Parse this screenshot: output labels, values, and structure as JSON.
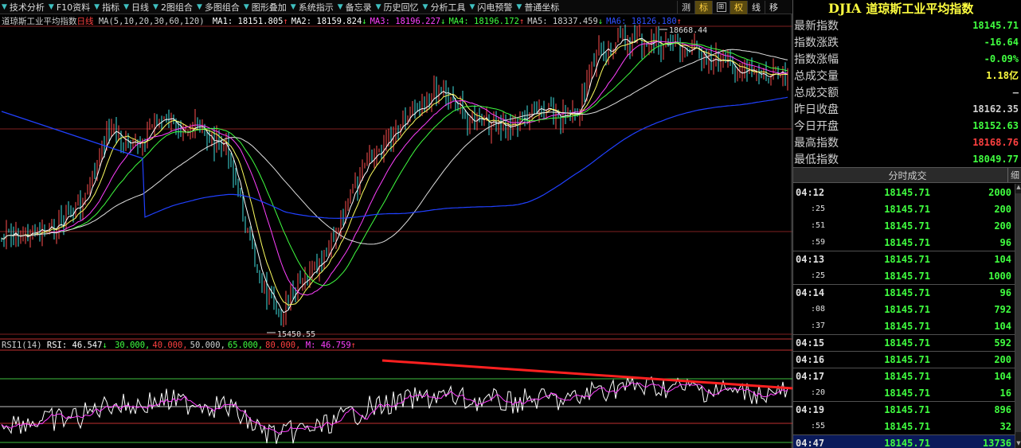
{
  "toolbar": {
    "items": [
      "技术分析",
      "F10资料",
      "指标",
      "日线",
      "2图组合",
      "多图组合",
      "图形叠加",
      "系统指示",
      "备忘录",
      "历史回忆",
      "分析工具",
      "闪电预警",
      "普通坐标"
    ],
    "mini": [
      "测",
      "标",
      "⊞",
      "权",
      "线",
      "移"
    ]
  },
  "chart": {
    "title": "道琼斯工业平均指数",
    "period": "日线",
    "ma_params": "MA(5,10,20,30,60,120)",
    "ma": [
      {
        "label": "MA1: 18151.805",
        "arrow": "↑",
        "color": "#ffffff"
      },
      {
        "label": "MA2: 18159.824",
        "arrow": "↓",
        "color": "#ffffff"
      },
      {
        "label": "MA3: 18196.227",
        "arrow": "↓",
        "color": "#ff40ff"
      },
      {
        "label": "MA4: 18196.172",
        "arrow": "↑",
        "color": "#40ff40"
      },
      {
        "label": "MA5: 18337.459",
        "arrow": "↓",
        "color": "#d0d0d0"
      },
      {
        "label": "MA6: 18126.180",
        "arrow": "↑",
        "color": "#3050ff"
      }
    ],
    "high_label": "18668.44",
    "low_label": "15450.55",
    "rsi": {
      "name": "RSI1(14)",
      "value": "RSI: 46.547",
      "value_arrow": "↓",
      "levels": [
        {
          "label": "30.000,",
          "color": "#40ff40"
        },
        {
          "label": "40.000,",
          "color": "#ff4040"
        },
        {
          "label": "50.000,",
          "color": "#d0d0d0"
        },
        {
          "label": "65.000,",
          "color": "#40ff40"
        },
        {
          "label": "80.000,",
          "color": "#ff4040"
        }
      ],
      "m": "M: 46.759",
      "m_arrow": "↑"
    }
  },
  "chart_data": {
    "type": "line",
    "title": "道琼斯工业平均指数",
    "price_range": [
      15450.55,
      18668.44
    ],
    "rsi_levels": [
      30,
      40,
      50,
      65,
      80
    ]
  },
  "panel": {
    "code": "DJIA",
    "name": "道琼斯工业平均指数",
    "stats": [
      {
        "label": "最新指数",
        "value": "18145.71",
        "color": "#40ff40"
      },
      {
        "label": "指数涨跌",
        "value": "-16.64",
        "color": "#40ff40"
      },
      {
        "label": "指数涨幅",
        "value": "-0.09%",
        "color": "#40ff40"
      },
      {
        "label": "总成交量",
        "value": "1.18亿",
        "color": "#ffff40"
      },
      {
        "label": "总成交额",
        "value": "—",
        "color": "#c0c0c0"
      },
      {
        "label": "昨日收盘",
        "value": "18162.35",
        "color": "#d0d0d0"
      },
      {
        "label": "今日开盘",
        "value": "18152.63",
        "color": "#40ff40"
      },
      {
        "label": "最高指数",
        "value": "18168.76",
        "color": "#ff4040"
      },
      {
        "label": "最低指数",
        "value": "18049.77",
        "color": "#40ff40"
      }
    ],
    "trades_header": "分时成交",
    "trades_detail": "细",
    "trades": [
      {
        "time": "04:12",
        "sub": false,
        "price": "18145.71",
        "vol": "2000"
      },
      {
        "time": ":25",
        "sub": true,
        "price": "18145.71",
        "vol": "200"
      },
      {
        "time": ":51",
        "sub": true,
        "price": "18145.71",
        "vol": "200"
      },
      {
        "time": ":59",
        "sub": true,
        "price": "18145.71",
        "vol": "96"
      },
      {
        "time": "04:13",
        "sub": false,
        "price": "18145.71",
        "vol": "104"
      },
      {
        "time": ":25",
        "sub": true,
        "price": "18145.71",
        "vol": "1000"
      },
      {
        "time": "04:14",
        "sub": false,
        "price": "18145.71",
        "vol": "96"
      },
      {
        "time": ":08",
        "sub": true,
        "price": "18145.71",
        "vol": "792"
      },
      {
        "time": ":37",
        "sub": true,
        "price": "18145.71",
        "vol": "104"
      },
      {
        "time": "04:15",
        "sub": false,
        "price": "18145.71",
        "vol": "592"
      },
      {
        "time": "04:16",
        "sub": false,
        "price": "18145.71",
        "vol": "200"
      },
      {
        "time": "04:17",
        "sub": false,
        "price": "18145.71",
        "vol": "104"
      },
      {
        "time": ":20",
        "sub": true,
        "price": "18145.71",
        "vol": "16"
      },
      {
        "time": "04:19",
        "sub": false,
        "price": "18145.71",
        "vol": "896"
      },
      {
        "time": ":55",
        "sub": true,
        "price": "18145.71",
        "vol": "32"
      },
      {
        "time": "04:47",
        "sub": false,
        "price": "18145.71",
        "vol": "13736",
        "last": true
      }
    ]
  }
}
